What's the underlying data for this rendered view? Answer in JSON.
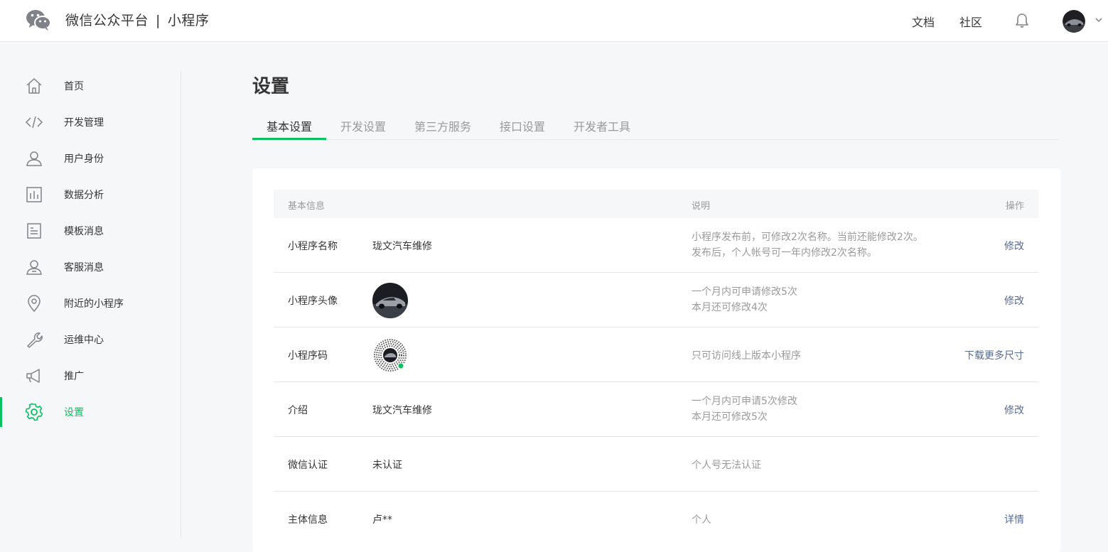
{
  "header": {
    "brand": "微信公众平台",
    "separator": "|",
    "product": "小程序",
    "links": [
      "文档",
      "社区"
    ],
    "icons": [
      "wechat-logo-icon",
      "bell-icon",
      "chevron-down-icon"
    ]
  },
  "sidebar": {
    "active_color": "#07c160",
    "items": [
      {
        "label": "首页",
        "icon": "home-icon"
      },
      {
        "label": "开发管理",
        "icon": "code-icon"
      },
      {
        "label": "用户身份",
        "icon": "user-icon"
      },
      {
        "label": "数据分析",
        "icon": "chart-icon"
      },
      {
        "label": "模板消息",
        "icon": "document-icon"
      },
      {
        "label": "客服消息",
        "icon": "service-icon"
      },
      {
        "label": "附近的小程序",
        "icon": "location-pin-icon"
      },
      {
        "label": "运维中心",
        "icon": "wrench-icon"
      },
      {
        "label": "推广",
        "icon": "megaphone-icon"
      },
      {
        "label": "设置",
        "icon": "gear-icon",
        "active": true
      }
    ]
  },
  "main": {
    "title": "设置",
    "tabs": [
      "基本设置",
      "开发设置",
      "第三方服务",
      "接口设置",
      "开发者工具"
    ],
    "active_tab": "基本设置",
    "table": {
      "headers": {
        "info": "基本信息",
        "desc": "说明",
        "action": "操作"
      },
      "rows": [
        {
          "key": "小程序名称",
          "value": "珑文汽车维修",
          "desc": [
            "小程序发布前，可修改2次名称。当前还能修改2次。",
            "发布后，个人帐号可一年内修改2次名称。"
          ],
          "action": "修改"
        },
        {
          "key": "小程序头像",
          "value": "",
          "desc": [
            "一个月内可申请修改5次",
            "本月还可修改4次"
          ],
          "action": "修改"
        },
        {
          "key": "小程序码",
          "value": "",
          "desc": [
            "只可访问线上版本小程序"
          ],
          "action": "下载更多尺寸"
        },
        {
          "key": "介绍",
          "value": "珑文汽车维修",
          "desc": [
            "一个月内可申请5次修改",
            "本月还可修改5次"
          ],
          "action": "修改"
        },
        {
          "key": "微信认证",
          "value": "未认证",
          "desc": [
            "个人号无法认证"
          ],
          "action": ""
        },
        {
          "key": "主体信息",
          "value": "卢**",
          "desc": [
            "个人"
          ],
          "action": "详情"
        }
      ]
    },
    "link_color": "#576b95"
  }
}
